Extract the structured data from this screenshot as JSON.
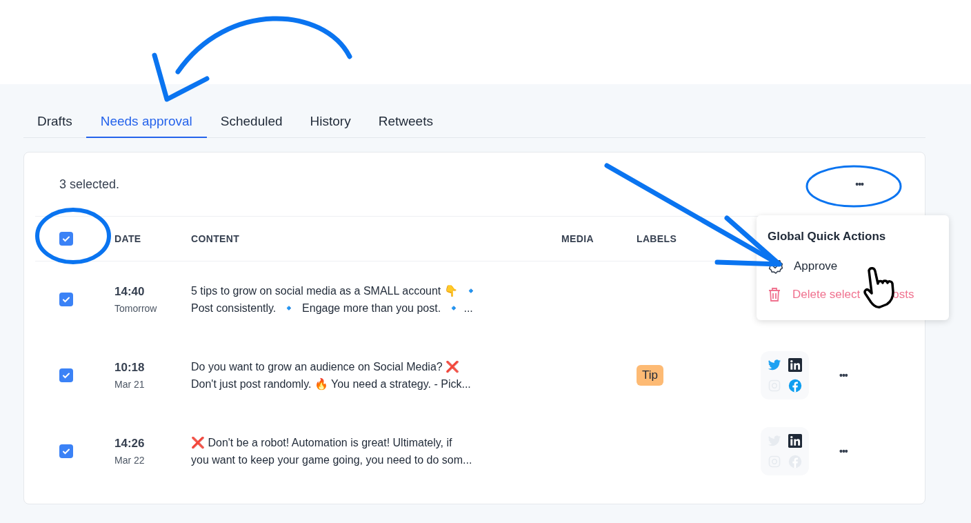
{
  "tabs": [
    {
      "label": "Drafts",
      "selected": false
    },
    {
      "label": "Needs approval",
      "selected": true
    },
    {
      "label": "Scheduled",
      "selected": false
    },
    {
      "label": "History",
      "selected": false
    },
    {
      "label": "Retweets",
      "selected": false
    }
  ],
  "selection_count": "3 selected.",
  "table": {
    "select_all_checked": true,
    "columns": [
      "DATE",
      "CONTENT",
      "MEDIA",
      "LABELS"
    ],
    "rows": [
      {
        "checked": true,
        "time": "14:40",
        "day": "Tomorrow",
        "content_lines": [
          "5 tips to grow on social media as a SMALL account 👇  🔹",
          "Post consistently.  🔹  Engage more than you post.  🔹 ..."
        ],
        "labels": [],
        "networks": []
      },
      {
        "checked": true,
        "time": "10:18",
        "day": "Mar 21",
        "content_lines": [
          "Do you want to grow an audience on Social Media? ❌",
          "Don't just post randomly. 🔥 You need a strategy. - Pick..."
        ],
        "labels": [
          "Tip"
        ],
        "networks": [
          {
            "kind": "twitter",
            "active": true
          },
          {
            "kind": "linkedin",
            "active": true
          },
          {
            "kind": "instagram",
            "active": false
          },
          {
            "kind": "facebook",
            "active": true
          }
        ],
        "more_button": "•••"
      },
      {
        "checked": true,
        "time": "14:26",
        "day": "Mar 22",
        "content_lines": [
          "❌ Don't be a robot! Automation is great! Ultimately, if",
          "you want to keep your game going, you need to do som..."
        ],
        "labels": [],
        "networks": [
          {
            "kind": "twitter",
            "active": false
          },
          {
            "kind": "linkedin",
            "active": true
          },
          {
            "kind": "instagram",
            "active": false
          },
          {
            "kind": "facebook",
            "active": false
          }
        ],
        "more_button": "•••"
      }
    ]
  },
  "global_more_button": "•••",
  "quick_actions_menu": {
    "title": "Global Quick Actions",
    "items": [
      {
        "kind": "approve",
        "label": "Approve"
      },
      {
        "kind": "delete",
        "label": "Delete select"
      },
      {
        "kind": "delete_tail",
        "label": "osts"
      }
    ]
  }
}
